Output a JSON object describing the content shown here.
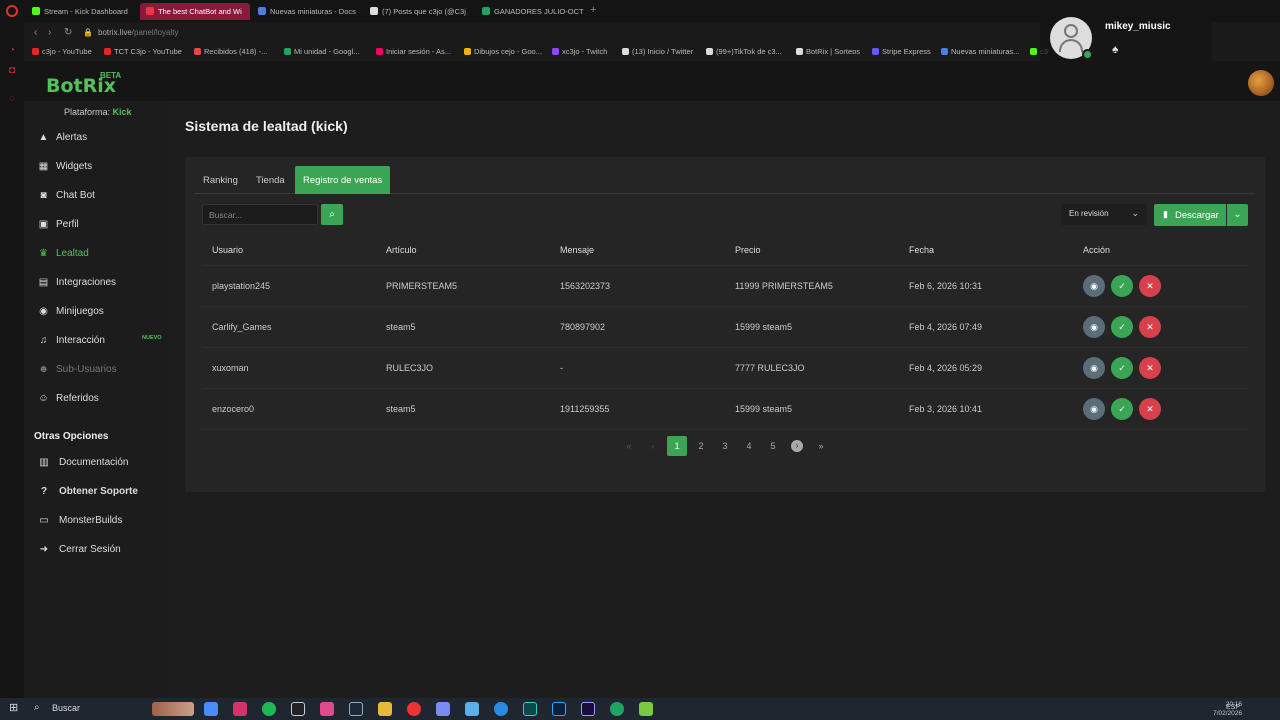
{
  "browser": {
    "tabs": [
      {
        "label": "Stream - Kick Dashboard",
        "color": "#53fc18"
      },
      {
        "label": "The best ChatBot and Wi",
        "color": "#e34",
        "active": true
      },
      {
        "label": "Nuevas miniaturas - Docs",
        "color": "#4a7ee0"
      },
      {
        "label": "(7) Posts que c3jo (@C3j",
        "color": "#ddd"
      },
      {
        "label": "GANADORES JULIO-OCT",
        "color": "#1fa463"
      }
    ],
    "url_host": "botrix.live",
    "url_path": "/panel/loyalty",
    "bookmarks": [
      {
        "label": "c3jo - YouTube",
        "color": "#e22"
      },
      {
        "label": "TCT C3jo - YouTube",
        "color": "#e22"
      },
      {
        "label": "Recibidos (418) -...",
        "color": "#e44"
      },
      {
        "label": "Mi unidad - Googl...",
        "color": "#1fa463"
      },
      {
        "label": "Iniciar sesión - As...",
        "color": "#f06"
      },
      {
        "label": "Dibujos cejo - Goo...",
        "color": "#f4b400"
      },
      {
        "label": "xc3jo - Twitch",
        "color": "#9146ff"
      },
      {
        "label": "(13) Inicio / Twitter",
        "color": "#ddd"
      },
      {
        "label": "(99+)TikTok de c3...",
        "color": "#ddd"
      },
      {
        "label": "BotRix | Sorteos",
        "color": "#ddd"
      },
      {
        "label": "Stripe Express",
        "color": "#635bff"
      },
      {
        "label": "Nuevas miniaturas...",
        "color": "#4a7ee0"
      },
      {
        "label": "c3",
        "color": "#53fc18"
      }
    ]
  },
  "overlay": {
    "username": "mikey_miusic"
  },
  "app": {
    "logo": "BotRix",
    "logo_badge": "BETA",
    "platform_label": "Plataforma:",
    "platform_value": "Kick"
  },
  "sidebar": {
    "items": [
      {
        "label": "Alertas",
        "icon": "warning-icon"
      },
      {
        "label": "Widgets",
        "icon": "grid-icon"
      },
      {
        "label": "Chat Bot",
        "icon": "robot-icon"
      },
      {
        "label": "Perfil",
        "icon": "id-card-icon"
      },
      {
        "label": "Lealtad",
        "icon": "trophy-icon",
        "active": true
      },
      {
        "label": "Integraciones",
        "icon": "plug-icon"
      },
      {
        "label": "Minijuegos",
        "icon": "gamepad-icon"
      },
      {
        "label": "Interacción",
        "icon": "music-icon"
      },
      {
        "label": "Sub-Usuarios",
        "icon": "users-icon",
        "dim": true
      },
      {
        "label": "Referidos",
        "icon": "user-group-icon"
      }
    ],
    "new_badge": "NUEVO",
    "section_title": "Otras Opciones",
    "other": [
      {
        "label": "Documentación",
        "icon": "book-icon"
      },
      {
        "label": "Obtener Soporte",
        "icon": "question-icon",
        "bold": true
      },
      {
        "label": "MonsterBuilds",
        "icon": "laptop-icon"
      },
      {
        "label": "Cerrar Sesión",
        "icon": "logout-icon"
      }
    ]
  },
  "page": {
    "title": "Sistema de lealtad (kick)",
    "tabs": [
      "Ranking",
      "Tienda",
      "Registro de ventas"
    ],
    "active_tab": 2,
    "search_placeholder": "Buscar...",
    "status_filter": "En revisión",
    "download_label": "Descargar"
  },
  "table": {
    "columns": [
      "Usuario",
      "Artículo",
      "Mensaje",
      "Precio",
      "Fecha",
      "Acción"
    ],
    "rows": [
      {
        "user": "playstation245",
        "item": "PRIMERSTEAM5",
        "message": "1563202373",
        "price": "11999 PRIMERSTEAM5",
        "date": "Feb 6, 2026 10:31"
      },
      {
        "user": "Carlify_Games",
        "item": "steam5",
        "message": "780897902",
        "price": "15999 steam5",
        "date": "Feb 4, 2026 07:49"
      },
      {
        "user": "xuxoman",
        "item": "RULEC3JO",
        "message": "-",
        "price": "7777 RULEC3JO",
        "date": "Feb 4, 2026 05:29"
      },
      {
        "user": "enzocero0",
        "item": "steam5",
        "message": "1911259355",
        "price": "15999 steam5",
        "date": "Feb 3, 2026 10:41"
      }
    ]
  },
  "pagination": {
    "pages": [
      "1",
      "2",
      "3",
      "4",
      "5"
    ],
    "current": "1",
    "first": "«",
    "prev": "‹",
    "next": "›",
    "last": "»"
  },
  "taskbar": {
    "search": "Buscar",
    "lang": "ESP",
    "time": "20:16",
    "date": "7/02/2026"
  },
  "colors": {
    "accent": "#3aa655",
    "danger": "#d8414c",
    "info": "#5a6e7a"
  }
}
